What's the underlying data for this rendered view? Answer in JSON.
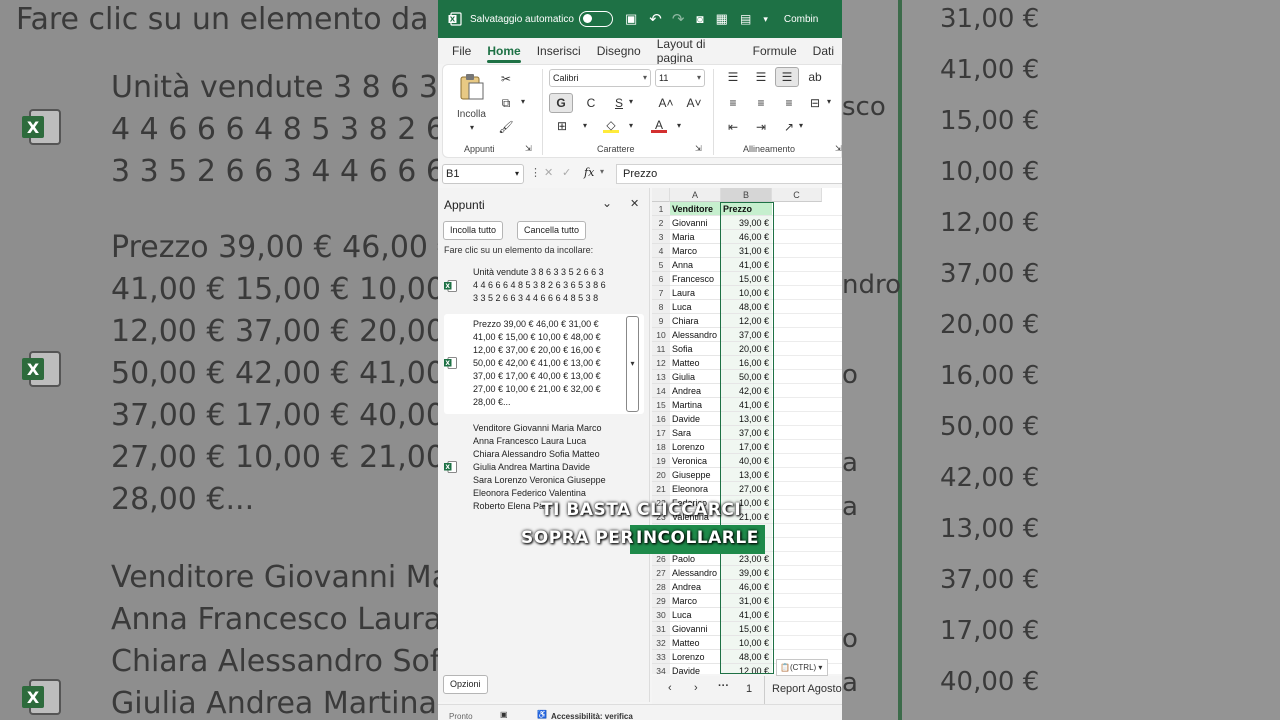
{
  "background": {
    "left_lines": [
      "Fare clic su un elemento da inc",
      "Unità vendute 3 8 6 3 3",
      "4 4 6 6 6 4 8 5 3 8 2 6 3",
      "3 3 5 2 6 6 3 4 4 6 6 6 4",
      "Prezzo 39,00 € 46,00 €",
      "41,00 € 15,00 € 10,00 €",
      "12,00 € 37,00 € 20,00 €",
      "50,00 € 42,00 € 41,00 €",
      "37,00 € 17,00 € 40,00 €",
      "27,00 € 10,00 € 21,00 €",
      "28,00 €...",
      "Venditore Giovanni Mar",
      "Anna Francesco Laura L",
      "Chiara Alessandro Sofia",
      "Giulia Andrea Martina D"
    ],
    "right_values": [
      "31,00 €",
      "41,00 €",
      "15,00 €",
      "10,00 €",
      "12,00 €",
      "37,00 €",
      "20,00 €",
      "16,00 €",
      "50,00 €",
      "42,00 €",
      "13,00 €",
      "37,00 €",
      "17,00 €",
      "40,00 €"
    ],
    "right_names": [
      "sco",
      "ndro",
      "o",
      "a",
      "a",
      "o",
      "a"
    ]
  },
  "titlebar": {
    "autosave_label": "Salvataggio automatico",
    "filename": "Combin"
  },
  "ribbon_tabs": [
    "File",
    "Home",
    "Inserisci",
    "Disegno",
    "Layout di pagina",
    "Formule",
    "Dati"
  ],
  "ribbon": {
    "paste_label": "Incolla",
    "group_clipboard": "Appunti",
    "group_font": "Carattere",
    "group_alignment": "Allineamento",
    "font_name": "Calibri",
    "font_size": "11",
    "bold": "G",
    "italic": "C",
    "underline": "S"
  },
  "formula_bar": {
    "name_box": "B1",
    "fx": "fx",
    "content": "Prezzo"
  },
  "clipboard_pane": {
    "title": "Appunti",
    "paste_all": "Incolla tutto",
    "clear_all": "Cancella tutto",
    "hint": "Fare clic su un elemento da incollare:",
    "items": [
      [
        "Unità vendute 3 8 6 3 3 5 2 6 6 3",
        "4 4 6 6 6 4 8 5 3 8 2 6 3 6 5 3 8 6",
        "3 3 5 2 6 6 3 4 4 6 6 6 4 8 5 3 8"
      ],
      [
        "Prezzo 39,00 € 46,00 € 31,00 €",
        "41,00 € 15,00 € 10,00 € 48,00 €",
        "12,00 € 37,00 € 20,00 € 16,00 €",
        "50,00 € 42,00 € 41,00 € 13,00 €",
        "37,00 € 17,00 € 40,00 € 13,00 €",
        "27,00 € 10,00 € 21,00 € 32,00 €",
        "28,00 €..."
      ],
      [
        "Venditore Giovanni Maria Marco",
        "Anna Francesco Laura Luca",
        "Chiara Alessandro Sofia Matteo",
        "Giulia Andrea Martina Davide",
        "Sara Lorenzo Veronica Giuseppe",
        "Eleonora Federico Valentina",
        "Roberto Elena Pa..."
      ]
    ],
    "options": "Opzioni"
  },
  "grid": {
    "columns": [
      "A",
      "B",
      "C"
    ],
    "rows": [
      [
        "1",
        "Venditore",
        "Prezzo"
      ],
      [
        "2",
        "Giovanni",
        "39,00 €"
      ],
      [
        "3",
        "Maria",
        "46,00 €"
      ],
      [
        "4",
        "Marco",
        "31,00 €"
      ],
      [
        "5",
        "Anna",
        "41,00 €"
      ],
      [
        "6",
        "Francesco",
        "15,00 €"
      ],
      [
        "7",
        "Laura",
        "10,00 €"
      ],
      [
        "8",
        "Luca",
        "48,00 €"
      ],
      [
        "9",
        "Chiara",
        "12,00 €"
      ],
      [
        "10",
        "Alessandro",
        "37,00 €"
      ],
      [
        "11",
        "Sofia",
        "20,00 €"
      ],
      [
        "12",
        "Matteo",
        "16,00 €"
      ],
      [
        "13",
        "Giulia",
        "50,00 €"
      ],
      [
        "14",
        "Andrea",
        "42,00 €"
      ],
      [
        "15",
        "Martina",
        "41,00 €"
      ],
      [
        "16",
        "Davide",
        "13,00 €"
      ],
      [
        "17",
        "Sara",
        "37,00 €"
      ],
      [
        "18",
        "Lorenzo",
        "17,00 €"
      ],
      [
        "19",
        "Veronica",
        "40,00 €"
      ],
      [
        "20",
        "Giuseppe",
        "13,00 €"
      ],
      [
        "21",
        "Eleonora",
        "27,00 €"
      ],
      [
        "22",
        "Federico",
        "10,00 €"
      ],
      [
        "23",
        "Valentina",
        "21,00 €"
      ],
      [
        "24",
        "",
        ""
      ],
      [
        "25",
        "",
        ""
      ],
      [
        "26",
        "Paolo",
        "23,00 €"
      ],
      [
        "27",
        "Alessandro",
        "39,00 €"
      ],
      [
        "28",
        "Andrea",
        "46,00 €"
      ],
      [
        "29",
        "Marco",
        "31,00 €"
      ],
      [
        "30",
        "Luca",
        "41,00 €"
      ],
      [
        "31",
        "Giovanni",
        "15,00 €"
      ],
      [
        "32",
        "Matteo",
        "10,00 €"
      ],
      [
        "33",
        "Lorenzo",
        "48,00 €"
      ],
      [
        "34",
        "Davide",
        "12,00 €"
      ]
    ]
  },
  "paste_options": "(CTRL)",
  "sheet_bar": {
    "page": "1",
    "sheet_name": "Report Agosto"
  },
  "status_bar": {
    "ready": "Pronto",
    "accessibility": "Accessibilità: verifica"
  },
  "caption": {
    "line1": "TI BASTA CLICCARCI",
    "line2a": "SOPRA PER",
    "line2b": "INCOLLARLE"
  },
  "colors": {
    "excel_green": "#1e7145",
    "header_fill": "#c6efce",
    "caption_highlight": "#1e8a4a"
  }
}
